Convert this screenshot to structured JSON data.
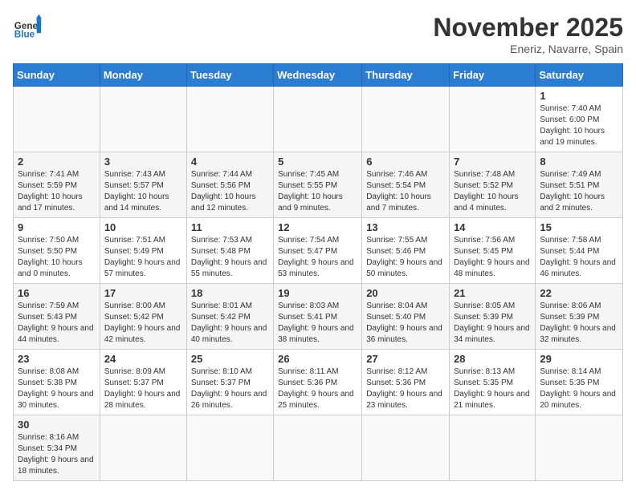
{
  "header": {
    "logo_general": "General",
    "logo_blue": "Blue",
    "month_title": "November 2025",
    "location": "Eneriz, Navarre, Spain"
  },
  "weekdays": [
    "Sunday",
    "Monday",
    "Tuesday",
    "Wednesday",
    "Thursday",
    "Friday",
    "Saturday"
  ],
  "weeks": [
    [
      {
        "day": "",
        "info": ""
      },
      {
        "day": "",
        "info": ""
      },
      {
        "day": "",
        "info": ""
      },
      {
        "day": "",
        "info": ""
      },
      {
        "day": "",
        "info": ""
      },
      {
        "day": "",
        "info": ""
      },
      {
        "day": "1",
        "info": "Sunrise: 7:40 AM\nSunset: 6:00 PM\nDaylight: 10 hours and 19 minutes."
      }
    ],
    [
      {
        "day": "2",
        "info": "Sunrise: 7:41 AM\nSunset: 5:59 PM\nDaylight: 10 hours and 17 minutes."
      },
      {
        "day": "3",
        "info": "Sunrise: 7:43 AM\nSunset: 5:57 PM\nDaylight: 10 hours and 14 minutes."
      },
      {
        "day": "4",
        "info": "Sunrise: 7:44 AM\nSunset: 5:56 PM\nDaylight: 10 hours and 12 minutes."
      },
      {
        "day": "5",
        "info": "Sunrise: 7:45 AM\nSunset: 5:55 PM\nDaylight: 10 hours and 9 minutes."
      },
      {
        "day": "6",
        "info": "Sunrise: 7:46 AM\nSunset: 5:54 PM\nDaylight: 10 hours and 7 minutes."
      },
      {
        "day": "7",
        "info": "Sunrise: 7:48 AM\nSunset: 5:52 PM\nDaylight: 10 hours and 4 minutes."
      },
      {
        "day": "8",
        "info": "Sunrise: 7:49 AM\nSunset: 5:51 PM\nDaylight: 10 hours and 2 minutes."
      }
    ],
    [
      {
        "day": "9",
        "info": "Sunrise: 7:50 AM\nSunset: 5:50 PM\nDaylight: 10 hours and 0 minutes."
      },
      {
        "day": "10",
        "info": "Sunrise: 7:51 AM\nSunset: 5:49 PM\nDaylight: 9 hours and 57 minutes."
      },
      {
        "day": "11",
        "info": "Sunrise: 7:53 AM\nSunset: 5:48 PM\nDaylight: 9 hours and 55 minutes."
      },
      {
        "day": "12",
        "info": "Sunrise: 7:54 AM\nSunset: 5:47 PM\nDaylight: 9 hours and 53 minutes."
      },
      {
        "day": "13",
        "info": "Sunrise: 7:55 AM\nSunset: 5:46 PM\nDaylight: 9 hours and 50 minutes."
      },
      {
        "day": "14",
        "info": "Sunrise: 7:56 AM\nSunset: 5:45 PM\nDaylight: 9 hours and 48 minutes."
      },
      {
        "day": "15",
        "info": "Sunrise: 7:58 AM\nSunset: 5:44 PM\nDaylight: 9 hours and 46 minutes."
      }
    ],
    [
      {
        "day": "16",
        "info": "Sunrise: 7:59 AM\nSunset: 5:43 PM\nDaylight: 9 hours and 44 minutes."
      },
      {
        "day": "17",
        "info": "Sunrise: 8:00 AM\nSunset: 5:42 PM\nDaylight: 9 hours and 42 minutes."
      },
      {
        "day": "18",
        "info": "Sunrise: 8:01 AM\nSunset: 5:42 PM\nDaylight: 9 hours and 40 minutes."
      },
      {
        "day": "19",
        "info": "Sunrise: 8:03 AM\nSunset: 5:41 PM\nDaylight: 9 hours and 38 minutes."
      },
      {
        "day": "20",
        "info": "Sunrise: 8:04 AM\nSunset: 5:40 PM\nDaylight: 9 hours and 36 minutes."
      },
      {
        "day": "21",
        "info": "Sunrise: 8:05 AM\nSunset: 5:39 PM\nDaylight: 9 hours and 34 minutes."
      },
      {
        "day": "22",
        "info": "Sunrise: 8:06 AM\nSunset: 5:39 PM\nDaylight: 9 hours and 32 minutes."
      }
    ],
    [
      {
        "day": "23",
        "info": "Sunrise: 8:08 AM\nSunset: 5:38 PM\nDaylight: 9 hours and 30 minutes."
      },
      {
        "day": "24",
        "info": "Sunrise: 8:09 AM\nSunset: 5:37 PM\nDaylight: 9 hours and 28 minutes."
      },
      {
        "day": "25",
        "info": "Sunrise: 8:10 AM\nSunset: 5:37 PM\nDaylight: 9 hours and 26 minutes."
      },
      {
        "day": "26",
        "info": "Sunrise: 8:11 AM\nSunset: 5:36 PM\nDaylight: 9 hours and 25 minutes."
      },
      {
        "day": "27",
        "info": "Sunrise: 8:12 AM\nSunset: 5:36 PM\nDaylight: 9 hours and 23 minutes."
      },
      {
        "day": "28",
        "info": "Sunrise: 8:13 AM\nSunset: 5:35 PM\nDaylight: 9 hours and 21 minutes."
      },
      {
        "day": "29",
        "info": "Sunrise: 8:14 AM\nSunset: 5:35 PM\nDaylight: 9 hours and 20 minutes."
      }
    ],
    [
      {
        "day": "30",
        "info": "Sunrise: 8:16 AM\nSunset: 5:34 PM\nDaylight: 9 hours and 18 minutes."
      },
      {
        "day": "",
        "info": ""
      },
      {
        "day": "",
        "info": ""
      },
      {
        "day": "",
        "info": ""
      },
      {
        "day": "",
        "info": ""
      },
      {
        "day": "",
        "info": ""
      },
      {
        "day": "",
        "info": ""
      }
    ]
  ]
}
